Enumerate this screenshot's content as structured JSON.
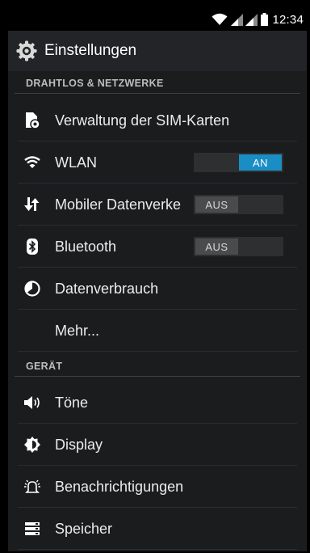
{
  "status_bar": {
    "time": "12:34"
  },
  "action_bar": {
    "title": "Einstellungen",
    "icon": "settings-gear-icon"
  },
  "sections": [
    {
      "header": "DRAHTLOS & NETZWERKE",
      "items": [
        {
          "label": "Verwaltung der SIM-Karten",
          "icon": "sim-card-icon"
        },
        {
          "label": "WLAN",
          "icon": "wifi-icon",
          "toggle": "AN",
          "toggle_on": true
        },
        {
          "label": "Mobiler Datenverkehr",
          "icon": "data-arrows-icon",
          "toggle": "AUS",
          "toggle_on": false
        },
        {
          "label": "Bluetooth",
          "icon": "bluetooth-icon",
          "toggle": "AUS",
          "toggle_on": false
        },
        {
          "label": "Datenverbrauch",
          "icon": "data-usage-icon"
        },
        {
          "label": "Mehr...",
          "icon": ""
        }
      ]
    },
    {
      "header": "GERÄT",
      "items": [
        {
          "label": "Töne",
          "icon": "speaker-icon"
        },
        {
          "label": "Display",
          "icon": "brightness-icon"
        },
        {
          "label": "Benachrichtigungen",
          "icon": "notification-bell-icon"
        },
        {
          "label": "Speicher",
          "icon": "storage-icon"
        }
      ]
    }
  ],
  "colors": {
    "screen_bg": "#1b1c1e",
    "action_bar_bg": "#222427",
    "toggle_on": "#1a8dc4",
    "toggle_off": "#4a4b4d"
  }
}
